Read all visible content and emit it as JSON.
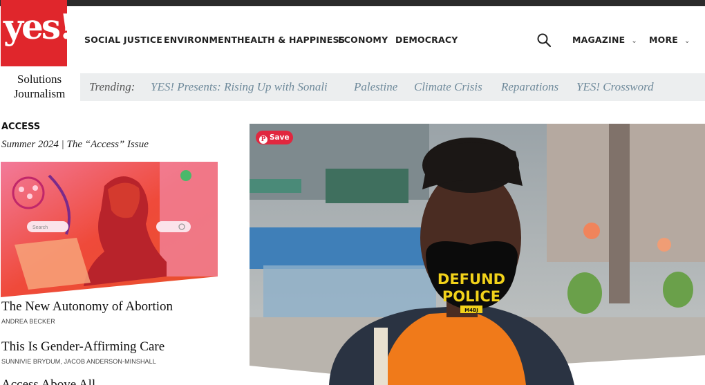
{
  "logo": {
    "text": "yes!",
    "tagline_line1": "Solutions",
    "tagline_line2": "Journalism"
  },
  "nav": {
    "items": [
      "SOCIAL JUSTICE",
      "ENVIRONMENT",
      "HEALTH & HAPPINESS",
      "ECONOMY",
      "DEMOCRACY"
    ],
    "magazine": "MAGAZINE",
    "more": "MORE"
  },
  "trending": {
    "label": "Trending:",
    "links": [
      "YES! Presents: Rising Up with Sonali",
      "Palestine",
      "Climate Crisis",
      "Reparations",
      "YES! Crossword"
    ]
  },
  "issue": {
    "section": "ACCESS",
    "subtitle": "Summer 2024 | The “Access” Issue",
    "cover_search_placeholder": "Search"
  },
  "articles": [
    {
      "title": "The New Autonomy of Abortion",
      "author": "ANDREA BECKER"
    },
    {
      "title": "This Is Gender-Affirming Care",
      "author": "SUNNIVIE BRYDUM, JACOB ANDERSON-MINSHALL"
    },
    {
      "title": "Access Above All"
    }
  ],
  "hero": {
    "save_label": "Save",
    "mask_line1": "DEFUND",
    "mask_line2": "POLICE",
    "mask_tag": "M4BJ"
  },
  "colors": {
    "brand_red": "#e0262c",
    "trending_link": "#6f8a9b",
    "pinterest_red": "#e1273f"
  }
}
